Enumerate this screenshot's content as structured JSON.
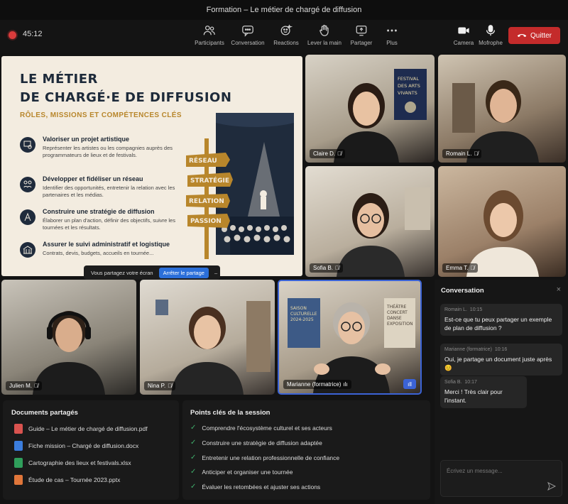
{
  "window": {
    "title": "Formation – Le métier de chargé de diffusion"
  },
  "toolbar": {
    "timer": "45:12",
    "buttons": [
      {
        "label": "Participants",
        "icon": "people-icon"
      },
      {
        "label": "Conversation",
        "icon": "chat-icon"
      },
      {
        "label": "Reactions",
        "icon": "reactions-icon"
      },
      {
        "label": "Lever la main",
        "icon": "hand-icon"
      },
      {
        "label": "Partager",
        "icon": "share-icon"
      },
      {
        "label": "Plus",
        "icon": "more-icon"
      },
      {
        "label": "Camera",
        "icon": "camera-icon"
      },
      {
        "label": "Mofrophe",
        "icon": "microphone-icon"
      }
    ],
    "quit_label": "Quitter"
  },
  "slide": {
    "title_line1": "LE MÉTIER",
    "title_line2": "DE CHARGÉ·E DE DIFFUSION",
    "subtitle": "RÔLES, MISSIONS ET COMPÉTENCES CLÉS",
    "items": [
      {
        "heading": "Valoriser un projet artistique",
        "text": "Représenter les artistes ou les compagnies auprès des programmateurs de lieux et de festivals."
      },
      {
        "heading": "Développer et fidéliser un réseau",
        "text": "Identifier des opportunités, entretenir la relation avec les partenaires et les médias."
      },
      {
        "heading": "Construire une stratégie de diffusion",
        "text": "Élaborer un plan d'action, définir des objectifs, suivre les tournées et les résultats."
      },
      {
        "heading": "Assurer le suivi administratif et logistique",
        "text": "Contrats, devis, budgets, accueils en tournée..."
      }
    ],
    "signs": [
      "RÉSEAU",
      "STRATÉGIE",
      "RELATION",
      "PASSION"
    ]
  },
  "share_bar": {
    "text": "Vous partagez votre écran",
    "stop_label": "Arrêter le partage",
    "minimize": "–"
  },
  "poster": {
    "line1": "FESTIVAL",
    "line2": "DES ARTS",
    "line3": "VIVANTS"
  },
  "poster2": {
    "line1": "SAISON",
    "line2": "CULTURELLE",
    "line3": "2024-2025"
  },
  "poster3": {
    "line1": "THÉÂTRE",
    "line2": "CONCERT",
    "line3": "DANSE",
    "line4": "EXPOSITION"
  },
  "participants": [
    {
      "name": "Claire D."
    },
    {
      "name": "Romain L."
    },
    {
      "name": "Sofia B."
    },
    {
      "name": "Emma T."
    },
    {
      "name": "Julien M."
    },
    {
      "name": "Nina P."
    },
    {
      "name": "Marianne (formatrice)"
    }
  ],
  "documents": {
    "title": "Documents partagés",
    "files": [
      {
        "name": "Guide – Le métier de chargé de diffusion.pdf",
        "color": "#d9534f"
      },
      {
        "name": "Fiche mission – Chargé de diffusion.docx",
        "color": "#3b7ddd"
      },
      {
        "name": "Cartographie des lieux et festivals.xlsx",
        "color": "#2f9e5b"
      },
      {
        "name": "Étude de cas – Tournée 2023.pptx",
        "color": "#e0763a"
      }
    ]
  },
  "keypoints": {
    "title": "Points clés de la session",
    "items": [
      "Comprendre l'écosystème culturel et ses acteurs",
      "Construire une stratégie de diffusion adaptée",
      "Entretenir une relation professionnelle de confiance",
      "Anticiper et organiser une tournée",
      "Évaluer les retombées et ajuster ses actions"
    ]
  },
  "conversation": {
    "title": "Conversation",
    "messages": [
      {
        "author": "Romain L.",
        "time": "10:15",
        "text": "Est-ce que tu peux partager un exemple de plan de diffusion ?"
      },
      {
        "author": "Marianne (formatrice)",
        "time": "10:16",
        "text": "Oui, je partage un document juste après 😊"
      },
      {
        "author": "Sofia B.",
        "time": "10:17",
        "text": "Merci ! Très clair pour l'instant."
      }
    ],
    "input_placeholder": "Écrivez un message..."
  },
  "colors": {
    "accent": "#2b6fd9",
    "quit": "#c42b2b",
    "slide_navy": "#1d2a3a",
    "slide_gold": "#b8862b"
  }
}
